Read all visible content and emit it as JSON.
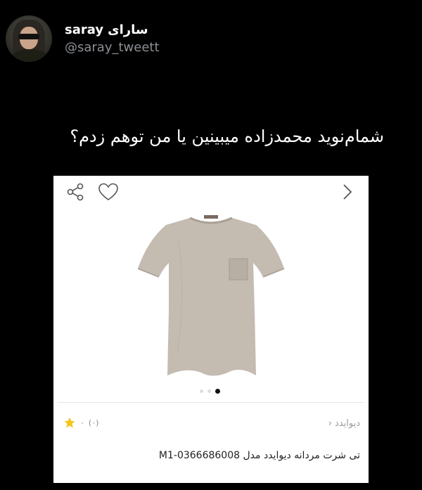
{
  "tweet": {
    "display_name": "saray",
    "display_name_fa": "سارای",
    "handle": "@saray_tweett",
    "text": "شمام‌نوید محمدزاده میبینین یا من توهم زدم؟"
  },
  "card": {
    "icons": [
      "share-icon",
      "heart-icon",
      "chevron-right-icon",
      "star-icon"
    ],
    "rating_count": "(۰)",
    "rating_value": "۰",
    "brand": "دیوایدد",
    "brand_chevron": "‹",
    "product_title": "تی شرت مردانه دیوایدد مدل M1-0366686008",
    "carousel": {
      "total": 3,
      "active_index": 2
    },
    "colors": {
      "star": "#f5c518",
      "shirt": "#c4bbb1"
    }
  }
}
